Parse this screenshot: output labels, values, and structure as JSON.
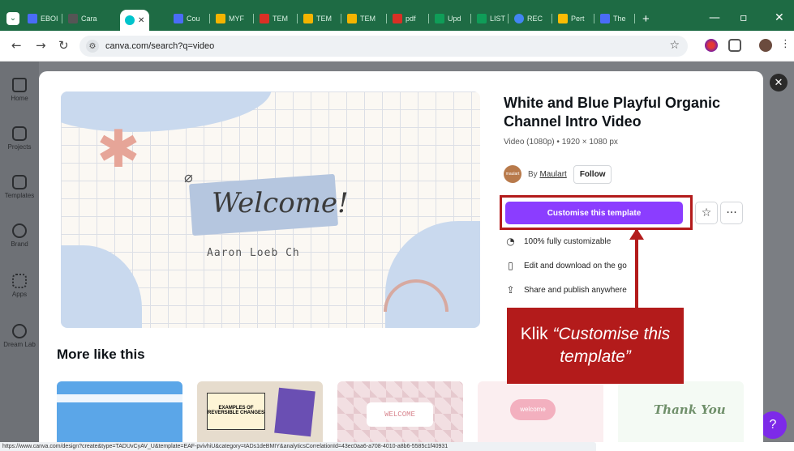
{
  "browser": {
    "tabs": [
      {
        "label": "EBOI",
        "color": "#4a6cf7"
      },
      {
        "label": "Cara",
        "color": "#555555"
      },
      {
        "label": "",
        "color": "#00c4cc",
        "active": true
      },
      {
        "label": "Cou",
        "color": "#4a6cf7"
      },
      {
        "label": "MYF",
        "color": "#f4b400"
      },
      {
        "label": "TEM",
        "color": "#d93025"
      },
      {
        "label": "TEM",
        "color": "#f4b400"
      },
      {
        "label": "TEM",
        "color": "#f4b400"
      },
      {
        "label": "pdf",
        "color": "#d93025"
      },
      {
        "label": "Upd",
        "color": "#0f9d58"
      },
      {
        "label": "LIST",
        "color": "#0f9d58"
      },
      {
        "label": "REC",
        "color": "#4285f4"
      },
      {
        "label": "Pert",
        "color": "#fbbc04"
      },
      {
        "label": "The",
        "color": "#4a6cf7"
      }
    ],
    "new_tab": "+",
    "url": "canva.com/search?q=video",
    "status_url": "https://www.canva.com/design?create&type=TADUvCyAV_U&template=EAF-pvivhiU&category=tADs1deBMIY&analyticsCorrelationId=43ec0aa6-a708-4010-a8b6-5585c1f40931"
  },
  "sidebar": {
    "items": [
      {
        "label": "Home"
      },
      {
        "label": "Projects"
      },
      {
        "label": "Templates"
      },
      {
        "label": "Brand"
      },
      {
        "label": "Apps"
      },
      {
        "label": "Dream Lab"
      }
    ]
  },
  "preview": {
    "welcome": "Welcome!",
    "author": "Aaron Loeb Ch"
  },
  "template": {
    "title": "White and Blue Playful Organic Channel Intro Video",
    "meta": "Video (1080p) • 1920 × 1080 px",
    "by_prefix": "By",
    "author": "Maulart",
    "avatar_text": "maulart",
    "follow_label": "Follow",
    "customise_label": "Customise this template",
    "features": [
      {
        "icon": "palette-icon",
        "label": "100% fully customizable"
      },
      {
        "icon": "phone-icon",
        "label": "Edit and download on the go"
      },
      {
        "icon": "share-icon",
        "label": "Share and publish anywhere"
      }
    ]
  },
  "more": {
    "title": "More like this",
    "thumbs": [
      {
        "text": ""
      },
      {
        "text": "EXAMPLES OF REVERSIBLE CHANGES"
      },
      {
        "text": "WELCOME"
      },
      {
        "text": "welcome"
      },
      {
        "text": "Thank You"
      }
    ]
  },
  "annotation": {
    "prefix": "Klik ",
    "italic": "“Customise this template”"
  },
  "help_label": "?"
}
